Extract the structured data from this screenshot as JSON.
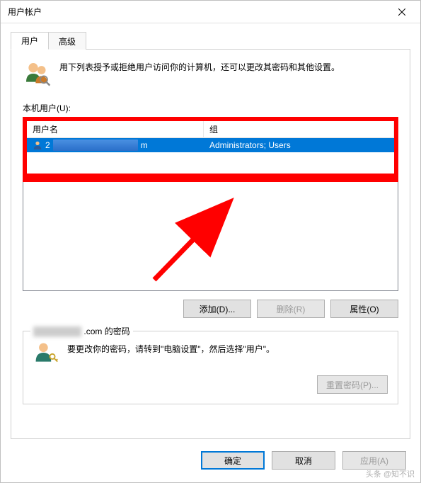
{
  "title": "用户帐户",
  "tabs": {
    "users": "用户",
    "advanced": "高级"
  },
  "intro": "用下列表授予或拒绝用户访问你的计算机，还可以更改其密码和其他设置。",
  "section_label": "本机用户(U):",
  "columns": {
    "username": "用户名",
    "group": "组"
  },
  "rows": [
    {
      "username_prefix": "2",
      "username_suffix": "m",
      "group": "Administrators; Users"
    }
  ],
  "buttons": {
    "add": "添加(D)...",
    "remove": "删除(R)",
    "properties": "属性(O)",
    "reset_pwd": "重置密码(P)...",
    "ok": "确定",
    "cancel": "取消",
    "apply": "应用(A)"
  },
  "password_group": {
    "legend_suffix": ".com 的密码",
    "text": "要更改你的密码，请转到\"电脑设置\"，然后选择\"用户\"。"
  },
  "watermark": "头条 @知不识"
}
